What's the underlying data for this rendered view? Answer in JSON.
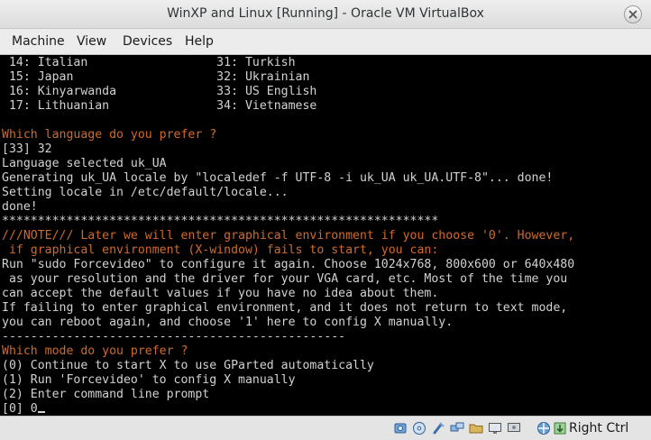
{
  "window": {
    "title": "WinXP and Linux [Running] - Oracle VM VirtualBox"
  },
  "menu": [
    {
      "label": "Machine"
    },
    {
      "label": "View"
    },
    {
      "label": "Devices"
    },
    {
      "label": "Help"
    }
  ],
  "terminal": {
    "lines": [
      {
        "text": " 14: Italian                  31: Turkish",
        "style": "normal"
      },
      {
        "text": " 15: Japan                    32: Ukrainian",
        "style": "normal"
      },
      {
        "text": " 16: Kinyarwanda              33: US English",
        "style": "normal"
      },
      {
        "text": " 17: Lithuanian               34: Vietnamese",
        "style": "normal"
      },
      {
        "text": "",
        "style": "normal"
      },
      {
        "text": "Which language do you prefer ?",
        "style": "orange"
      },
      {
        "text": "[33] 32",
        "style": "normal"
      },
      {
        "text": "Language selected uk_UA",
        "style": "normal"
      },
      {
        "text": "Generating uk_UA locale by \"localedef -f UTF-8 -i uk_UA uk_UA.UTF-8\"... done!",
        "style": "normal"
      },
      {
        "text": "Setting locale in /etc/default/locale...",
        "style": "normal"
      },
      {
        "text": "done!",
        "style": "normal"
      },
      {
        "text": "*************************************************************",
        "style": "normal"
      },
      {
        "text": "///NOTE/// Later we will enter graphical environment if you choose '0'. However,",
        "style": "orange"
      },
      {
        "text": " if graphical environment (X-window) fails to start, you can:",
        "style": "orange"
      },
      {
        "text": "Run \"sudo Forcevideo\" to configure it again. Choose 1024x768, 800x600 or 640x480",
        "style": "normal"
      },
      {
        "text": " as your resolution and the driver for your VGA card, etc. Most of the time you",
        "style": "normal"
      },
      {
        "text": "can accept the default values if you have no idea about them.",
        "style": "normal"
      },
      {
        "text": "If failing to enter graphical environment, and it does not return to text mode,",
        "style": "normal"
      },
      {
        "text": "you can reboot again, and choose '1' here to config X manually.",
        "style": "normal"
      },
      {
        "text": "------------------------------------------------",
        "style": "normal"
      },
      {
        "text": "Which mode do you prefer ?",
        "style": "orange"
      },
      {
        "text": "(0) Continue to start X to use GParted automatically",
        "style": "normal"
      },
      {
        "text": "(1) Run 'Forcevideo' to config X manually",
        "style": "normal"
      },
      {
        "text": "(2) Enter command line prompt",
        "style": "normal"
      },
      {
        "text": "[0] 0",
        "style": "normal"
      }
    ]
  },
  "status": {
    "icons": [
      "hard-disk-icon",
      "optical-disc-icon",
      "usb-icon",
      "network-icon",
      "shared-folders-icon",
      "display-icon",
      "video-capture-icon",
      "mouse-integration-icon",
      "keyboard-capture-icon"
    ],
    "host_key": "Right Ctrl"
  },
  "colors": {
    "terminal_text": "#d2d2d2",
    "terminal_highlight": "#d06a2a",
    "terminal_bg": "#000000"
  }
}
